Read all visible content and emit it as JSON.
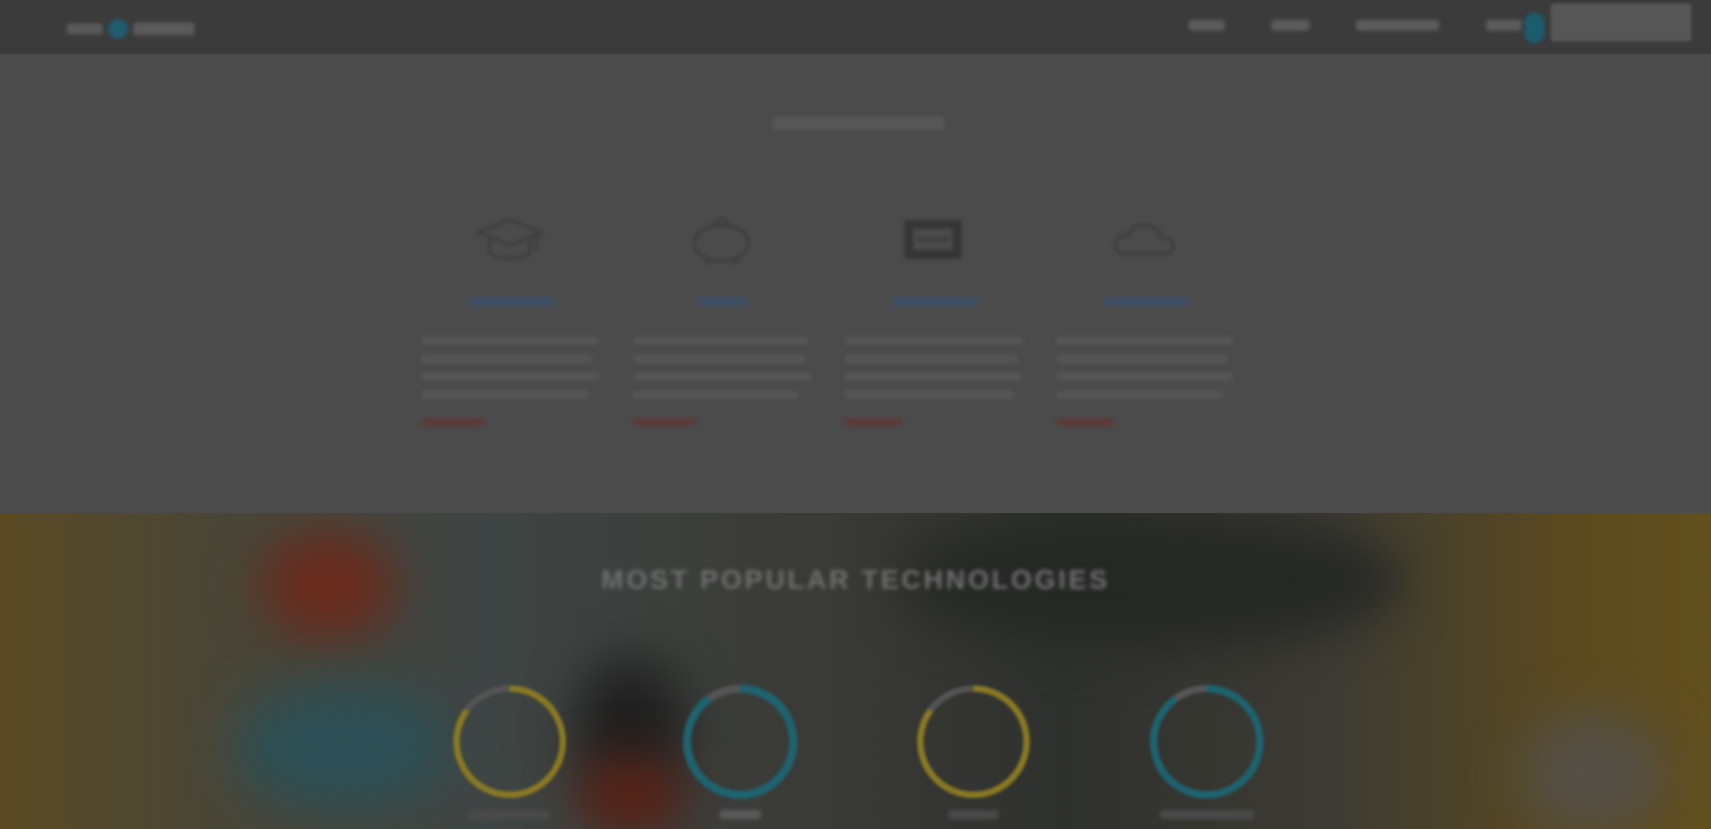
{
  "header": {
    "logo_text": "",
    "nav": [
      {
        "label": ""
      },
      {
        "label": ""
      },
      {
        "label": ""
      },
      {
        "label": ""
      }
    ],
    "signin_label": ""
  },
  "features_section": {
    "title": "",
    "items": [
      {
        "icon": "graduation-cap-icon",
        "title": "",
        "description": "",
        "more_link": ""
      },
      {
        "icon": "piggy-bank-icon",
        "title": "",
        "description": "",
        "more_link": ""
      },
      {
        "icon": "certificate-icon",
        "title": "",
        "description": "",
        "more_link": ""
      },
      {
        "icon": "cloud-icon",
        "title": "",
        "description": "",
        "more_link": ""
      }
    ]
  },
  "technologies_section": {
    "title": "MOST POPULAR TECHNOLOGIES",
    "items": [
      {
        "name": "",
        "progress": 0.85,
        "color": "#8a7a22"
      },
      {
        "name": "",
        "progress": 0.9,
        "color": "#1d6470"
      },
      {
        "name": "",
        "progress": 0.85,
        "color": "#8a7a22"
      },
      {
        "name": "",
        "progress": 0.9,
        "color": "#1d6470"
      }
    ]
  },
  "colors": {
    "overlay": "#4b4b4b",
    "topbar": "#3b3b3b",
    "accent_teal": "#1d6470",
    "accent_yellow": "#8a7a22",
    "accent_red": "#5e3838"
  }
}
